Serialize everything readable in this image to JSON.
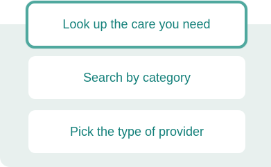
{
  "options": [
    {
      "label": "Look up the care you need",
      "selected": true
    },
    {
      "label": "Search by category",
      "selected": false
    },
    {
      "label": "Pick the type of provider",
      "selected": false
    }
  ],
  "colors": {
    "accent_text": "#14807a",
    "selected_border": "#4fa89e",
    "panel_background": "#e8f0ee",
    "card_background": "#ffffff"
  }
}
